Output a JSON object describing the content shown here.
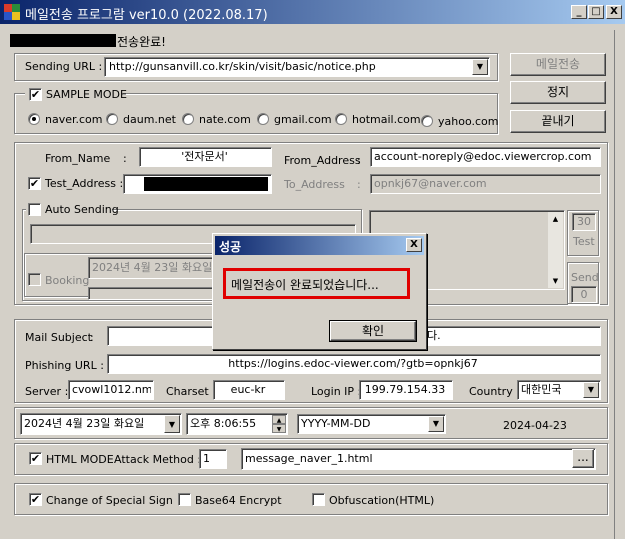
{
  "window": {
    "title": "메일전송 프로그람 ver10.0 (2022.08.17)",
    "minimize": "_",
    "maximize": "□",
    "close": "X"
  },
  "status": {
    "text": "전송완료!"
  },
  "sending": {
    "label": "Sending URL :",
    "url": "http://gunsanvill.co.kr/skin/visit/basic/notice.php"
  },
  "buttons": {
    "send": "메일전송",
    "stop": "정지",
    "exit": "끝내기"
  },
  "sample_mode": {
    "label": "SAMPLE MODE",
    "checked": true,
    "options": [
      "naver.com",
      "daum.net",
      "nate.com",
      "gmail.com",
      "hotmail.com",
      "yahoo.com"
    ],
    "selected": "naver.com"
  },
  "from": {
    "name_label": "From_Name",
    "name_sep": ":",
    "name_value": "'전자문서'",
    "address_label": "From_Address",
    "address_value": "account-noreply@edoc.viewercrop.com",
    "test_label": "Test_Address :",
    "to_label": "To_Address",
    "to_value": "opnkj67@naver.com"
  },
  "auto": {
    "label": "Auto Sending",
    "booking_label": "Booking",
    "booking_date": "2024년   4월 23일 화요일",
    "count_30": "30",
    "test_label": "Test",
    "send_label": "Send",
    "send_count": "0"
  },
  "dialog": {
    "title": "성공",
    "message": "메일전송이 완료되었습니다...",
    "ok": "확인"
  },
  "mail": {
    "subject_label": "Mail Subject",
    "subject_tail": "다.",
    "phishing_label": "Phishing URL :",
    "phishing_url": "https://logins.edoc-viewer.com/?gtb=opnkj67",
    "server_label": "Server :",
    "server": "cvowl1012.nm",
    "charset_label": "Charset :",
    "charset": "euc-kr",
    "login_ip_label": "Login IP :",
    "login_ip": "199.79.154.33",
    "country_label": "Country :",
    "country": "대한민국"
  },
  "datetime": {
    "date": "2024년   4월 23일 화요일",
    "time": "오후   8:06:55",
    "format": "YYYY-MM-DD",
    "formatted": "2024-04-23"
  },
  "html_mode": {
    "label": "HTML MODE",
    "attack_label": "Attack Method :",
    "attack_value": "1",
    "file": "message_naver_1.html",
    "browse": "..."
  },
  "options": {
    "special_sign": "Change of Special Sign",
    "base64": "Base64 Encrypt",
    "obfuscation": "Obfuscation(HTML)"
  },
  "colors": {
    "titlebar_start": "#0a246a",
    "titlebar_end": "#a6caf0",
    "dialog_highlight": "#e00000",
    "face": "#d4d0c8"
  }
}
